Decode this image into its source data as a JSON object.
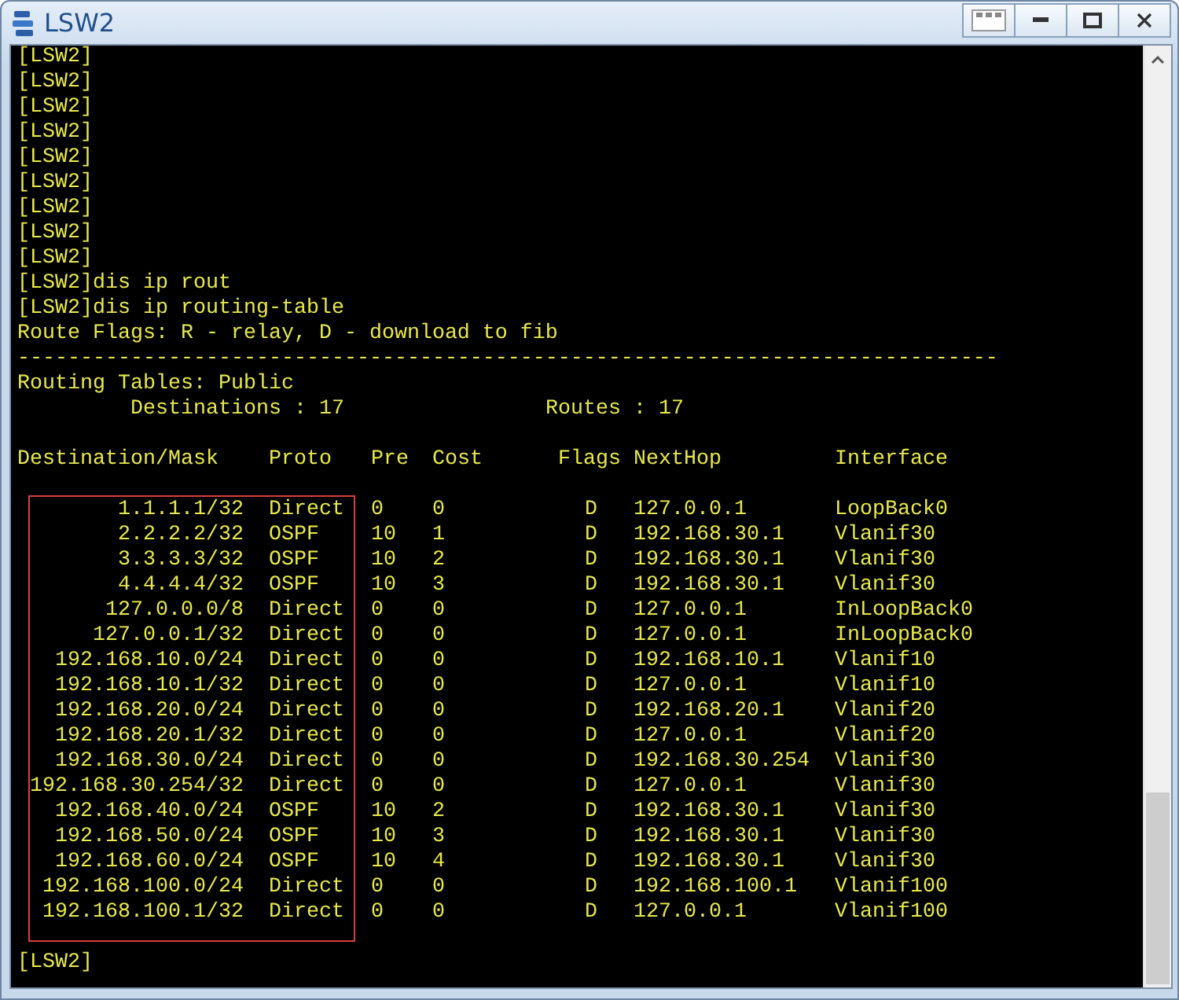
{
  "window": {
    "title": "LSW2"
  },
  "terminal": {
    "lines": [
      "[LSW2]",
      "[LSW2]",
      "[LSW2]",
      "[LSW2]",
      "[LSW2]",
      "[LSW2]",
      "[LSW2]",
      "[LSW2]",
      "[LSW2]",
      "[LSW2]dis ip rout",
      "[LSW2]dis ip routing-table",
      "Route Flags: R - relay, D - download to fib",
      "------------------------------------------------------------------------------"
    ],
    "table_title": "Routing Tables: Public",
    "summary": [
      "Destinations : 17",
      "Routes : 17"
    ],
    "columns": [
      "Destination/Mask",
      "Proto",
      "Pre",
      "Cost",
      "Flags",
      "NextHop",
      "Interface"
    ],
    "rows": [
      {
        "destination": "1.1.1.1/32",
        "proto": "Direct",
        "pre": "0",
        "cost": "0",
        "flags": "D",
        "nexthop": "127.0.0.1",
        "interface": "LoopBack0"
      },
      {
        "destination": "2.2.2.2/32",
        "proto": "OSPF",
        "pre": "10",
        "cost": "1",
        "flags": "D",
        "nexthop": "192.168.30.1",
        "interface": "Vlanif30"
      },
      {
        "destination": "3.3.3.3/32",
        "proto": "OSPF",
        "pre": "10",
        "cost": "2",
        "flags": "D",
        "nexthop": "192.168.30.1",
        "interface": "Vlanif30"
      },
      {
        "destination": "4.4.4.4/32",
        "proto": "OSPF",
        "pre": "10",
        "cost": "3",
        "flags": "D",
        "nexthop": "192.168.30.1",
        "interface": "Vlanif30"
      },
      {
        "destination": "127.0.0.0/8",
        "proto": "Direct",
        "pre": "0",
        "cost": "0",
        "flags": "D",
        "nexthop": "127.0.0.1",
        "interface": "InLoopBack0"
      },
      {
        "destination": "127.0.0.1/32",
        "proto": "Direct",
        "pre": "0",
        "cost": "0",
        "flags": "D",
        "nexthop": "127.0.0.1",
        "interface": "InLoopBack0"
      },
      {
        "destination": "192.168.10.0/24",
        "proto": "Direct",
        "pre": "0",
        "cost": "0",
        "flags": "D",
        "nexthop": "192.168.10.1",
        "interface": "Vlanif10"
      },
      {
        "destination": "192.168.10.1/32",
        "proto": "Direct",
        "pre": "0",
        "cost": "0",
        "flags": "D",
        "nexthop": "127.0.0.1",
        "interface": "Vlanif10"
      },
      {
        "destination": "192.168.20.0/24",
        "proto": "Direct",
        "pre": "0",
        "cost": "0",
        "flags": "D",
        "nexthop": "192.168.20.1",
        "interface": "Vlanif20"
      },
      {
        "destination": "192.168.20.1/32",
        "proto": "Direct",
        "pre": "0",
        "cost": "0",
        "flags": "D",
        "nexthop": "127.0.0.1",
        "interface": "Vlanif20"
      },
      {
        "destination": "192.168.30.0/24",
        "proto": "Direct",
        "pre": "0",
        "cost": "0",
        "flags": "D",
        "nexthop": "192.168.30.254",
        "interface": "Vlanif30"
      },
      {
        "destination": "192.168.30.254/32",
        "proto": "Direct",
        "pre": "0",
        "cost": "0",
        "flags": "D",
        "nexthop": "127.0.0.1",
        "interface": "Vlanif30"
      },
      {
        "destination": "192.168.40.0/24",
        "proto": "OSPF",
        "pre": "10",
        "cost": "2",
        "flags": "D",
        "nexthop": "192.168.30.1",
        "interface": "Vlanif30"
      },
      {
        "destination": "192.168.50.0/24",
        "proto": "OSPF",
        "pre": "10",
        "cost": "3",
        "flags": "D",
        "nexthop": "192.168.30.1",
        "interface": "Vlanif30"
      },
      {
        "destination": "192.168.60.0/24",
        "proto": "OSPF",
        "pre": "10",
        "cost": "4",
        "flags": "D",
        "nexthop": "192.168.30.1",
        "interface": "Vlanif30"
      },
      {
        "destination": "192.168.100.0/24",
        "proto": "Direct",
        "pre": "0",
        "cost": "0",
        "flags": "D",
        "nexthop": "192.168.100.1",
        "interface": "Vlanif100"
      },
      {
        "destination": "192.168.100.1/32",
        "proto": "Direct",
        "pre": "0",
        "cost": "0",
        "flags": "D",
        "nexthop": "127.0.0.1",
        "interface": "Vlanif100"
      }
    ],
    "prompt": "[LSW2]"
  }
}
